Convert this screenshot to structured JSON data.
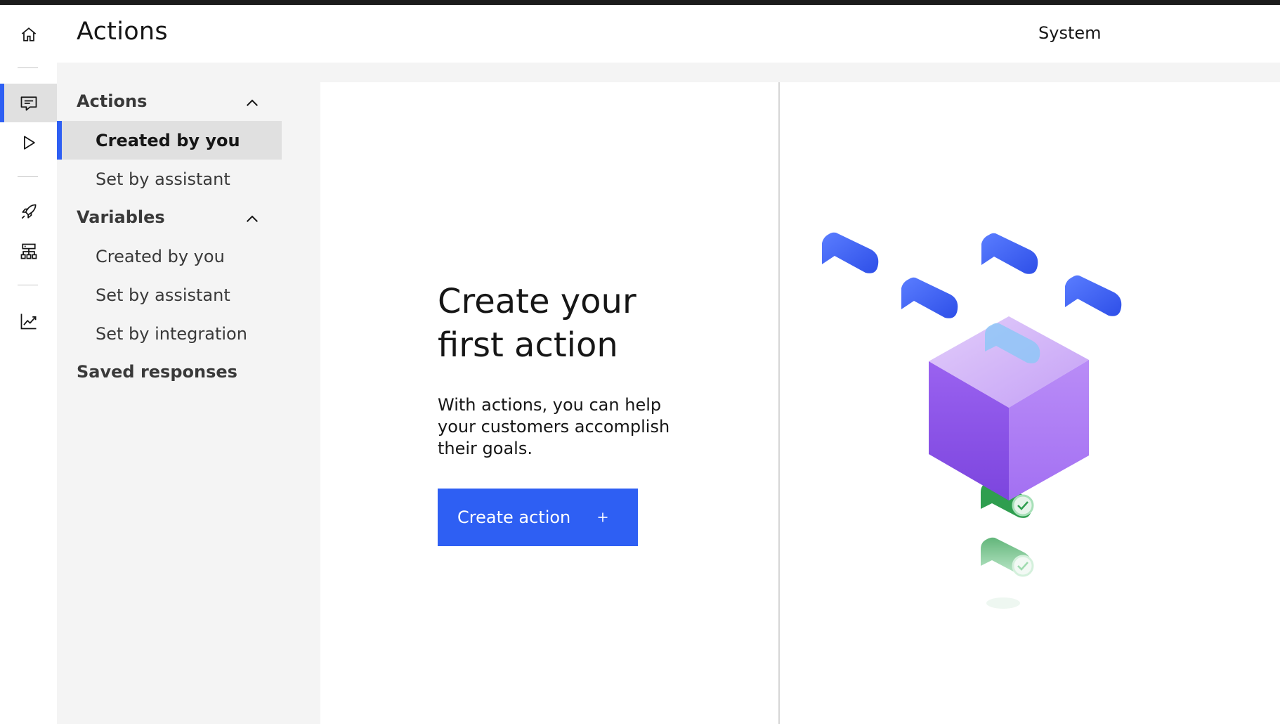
{
  "header": {
    "title": "Actions",
    "right_label": "System"
  },
  "rail": {
    "items": [
      {
        "icon": "home-icon"
      },
      {
        "icon": "chat-icon",
        "active": true
      },
      {
        "icon": "play-icon"
      },
      {
        "icon": "rocket-icon"
      },
      {
        "icon": "integrations-icon"
      },
      {
        "icon": "analytics-icon"
      }
    ]
  },
  "sidenav": {
    "sections": [
      {
        "label": "Actions",
        "expanded": true,
        "items": [
          {
            "label": "Created by you",
            "selected": true
          },
          {
            "label": "Set by assistant"
          }
        ]
      },
      {
        "label": "Variables",
        "expanded": true,
        "items": [
          {
            "label": "Created by you"
          },
          {
            "label": "Set by assistant"
          },
          {
            "label": "Set by integration"
          }
        ]
      },
      {
        "label": "Saved responses"
      }
    ]
  },
  "empty_state": {
    "title_line1": "Create your",
    "title_line2": "first action",
    "description": "With actions, you can help your customers accomplish their goals.",
    "button_label": "Create action"
  },
  "colors": {
    "accent": "#2e5ff3",
    "nav_bg": "#f4f4f4",
    "selected_bg": "#e0e0e0",
    "cube_purple": "#a56eff",
    "bubble_blue": "#4a6cf7",
    "bubble_green": "#42be65"
  }
}
